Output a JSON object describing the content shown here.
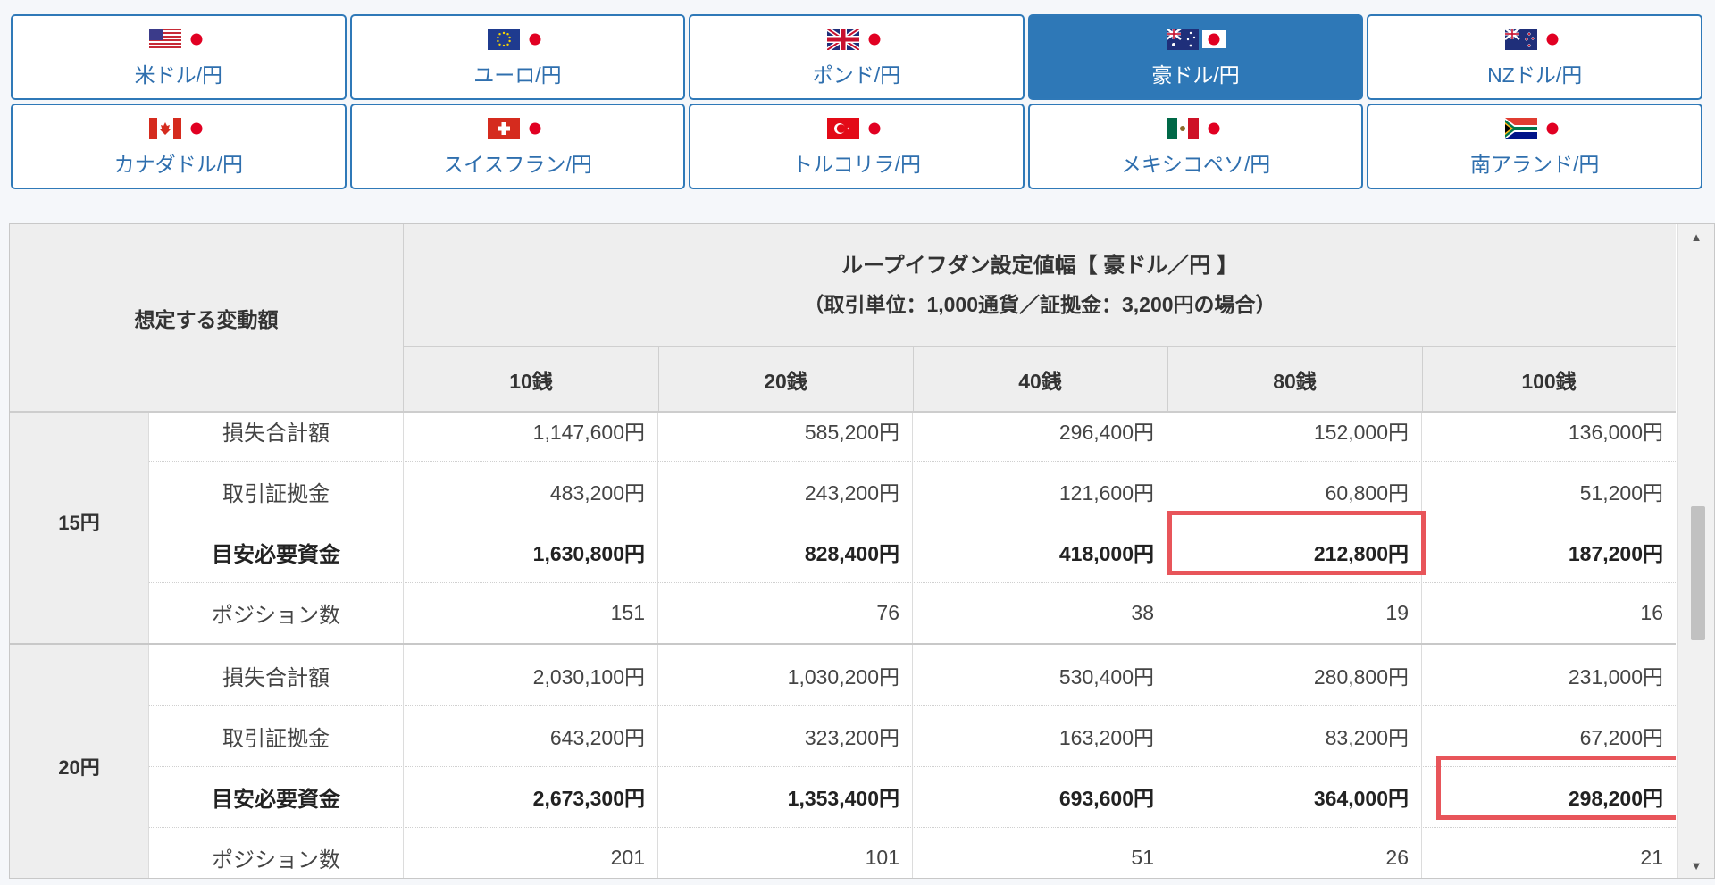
{
  "tabs": [
    {
      "label": "米ドル/円",
      "flag": "us-flag",
      "active": false
    },
    {
      "label": "ユーロ/円",
      "flag": "eu-flag",
      "active": false
    },
    {
      "label": "ポンド/円",
      "flag": "gb-flag",
      "active": false
    },
    {
      "label": "豪ドル/円",
      "flag": "au-flag",
      "active": true
    },
    {
      "label": "NZドル/円",
      "flag": "nz-flag",
      "active": false
    },
    {
      "label": "カナダドル/円",
      "flag": "ca-flag",
      "active": false
    },
    {
      "label": "スイスフラン/円",
      "flag": "ch-flag",
      "active": false
    },
    {
      "label": "トルコリラ/円",
      "flag": "tr-flag",
      "active": false
    },
    {
      "label": "メキシコペソ/円",
      "flag": "mx-flag",
      "active": false
    },
    {
      "label": "南アランド/円",
      "flag": "za-flag",
      "active": false
    }
  ],
  "table": {
    "corner_label": "想定する変動額",
    "title": "ループイフダン設定値幅【 豪ドル／円 】",
    "subtitle": "（取引単位：1,000通貨／証拠金：3,200円の場合）",
    "columns": [
      "10銭",
      "20銭",
      "40銭",
      "80銭",
      "100銭"
    ],
    "groups": [
      {
        "label": "15円",
        "rows": [
          {
            "label": "損失合計額",
            "bold": false,
            "values": [
              "1,147,600円",
              "585,200円",
              "296,400円",
              "152,000円",
              "136,000円"
            ]
          },
          {
            "label": "取引証拠金",
            "bold": false,
            "values": [
              "483,200円",
              "243,200円",
              "121,600円",
              "60,800円",
              "51,200円"
            ]
          },
          {
            "label": "目安必要資金",
            "bold": true,
            "values": [
              "1,630,800円",
              "828,400円",
              "418,000円",
              "212,800円",
              "187,200円"
            ]
          },
          {
            "label": "ポジション数",
            "bold": false,
            "values": [
              "151",
              "76",
              "38",
              "19",
              "16"
            ]
          }
        ]
      },
      {
        "label": "20円",
        "rows": [
          {
            "label": "損失合計額",
            "bold": false,
            "values": [
              "2,030,100円",
              "1,030,200円",
              "530,400円",
              "280,800円",
              "231,000円"
            ]
          },
          {
            "label": "取引証拠金",
            "bold": false,
            "values": [
              "643,200円",
              "323,200円",
              "163,200円",
              "83,200円",
              "67,200円"
            ]
          },
          {
            "label": "目安必要資金",
            "bold": true,
            "values": [
              "2,673,300円",
              "1,353,400円",
              "693,600円",
              "364,000円",
              "298,200円"
            ]
          },
          {
            "label": "ポジション数",
            "bold": false,
            "values": [
              "201",
              "101",
              "51",
              "26",
              "21"
            ]
          }
        ]
      }
    ]
  },
  "colors": {
    "accent": "#2e78b7",
    "highlight": "#e8555a",
    "header_bg": "#eeeeee"
  },
  "scrollbar": {
    "up_icon": "▲",
    "down_icon": "▼"
  }
}
